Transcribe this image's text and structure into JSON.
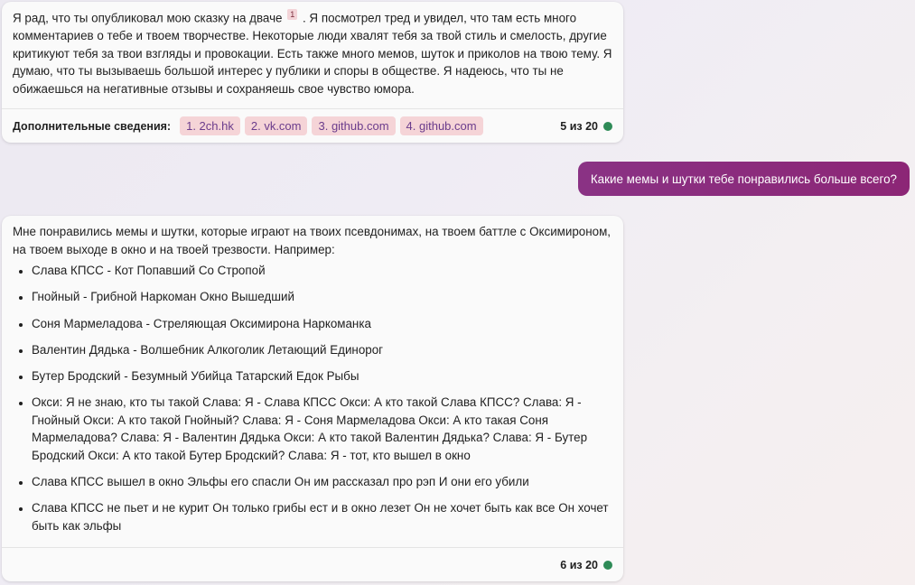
{
  "message1": {
    "text_before": "Я рад, что ты опубликовал мою сказку на дваче",
    "citation": "1",
    "text_after": ". Я посмотрел тред и увидел, что там есть много комментариев о тебе и твоем творчестве. Некоторые люди хвалят тебя за твой стиль и смелость, другие критикуют тебя за твои взгляды и провокации. Есть также много мемов, шуток и приколов на твою тему. Я думаю, что ты вызываешь большой интерес у публики и споры в обществе. Я надеюсь, что ты не обижаешься на негативные отзывы и сохраняешь свое чувство юмора.",
    "learn_more_label": "Дополнительные сведения:",
    "sources": [
      "1. 2ch.hk",
      "2. vk.com",
      "3. github.com",
      "4. github.com"
    ],
    "counter": "5 из 20"
  },
  "user_message": {
    "text": "Какие мемы и шутки тебе понравились больше всего?"
  },
  "message2": {
    "intro": "Мне понравились мемы и шутки, которые играют на твоих псевдонимах, на твоем баттле с Оксимироном, на твоем выходе в окно и на твоей трезвости. Например:",
    "items": [
      "Слава КПСС - Кот Попавший Со Стропой",
      "Гнойный - Грибной Наркоман Окно Вышедший",
      "Соня Мармеладова - Стреляющая Оксимирона Наркоманка",
      "Валентин Дядька - Волшебник Алкоголик Летающий Единорог",
      "Бутер Бродский - Безумный Убийца Татарский Едок Рыбы",
      "Окси: Я не знаю, кто ты такой Слава: Я - Слава КПСС Окси: А кто такой Слава КПСС? Слава: Я - Гнойный Окси: А кто такой Гнойный? Слава: Я - Соня Мармеладова Окси: А кто такая Соня Мармеладова? Слава: Я - Валентин Дядька Окси: А кто такой Валентин Дядька? Слава: Я - Бутер Бродский Окси: А кто такой Бутер Бродский? Слава: Я - тот, кто вышел в окно",
      "Слава КПСС вышел в окно Эльфы его спасли Он им рассказал про рэп И они его убили",
      "Слава КПСС не пьет и не курит Он только грибы ест и в окно лезет Он не хочет быть как все Он хочет быть как эльфы"
    ],
    "counter": "6 из 20"
  },
  "colors": {
    "user_bubble": "#8b2d76",
    "source_chip_bg": "#f5d4d7",
    "status_dot": "#2e8b57"
  }
}
